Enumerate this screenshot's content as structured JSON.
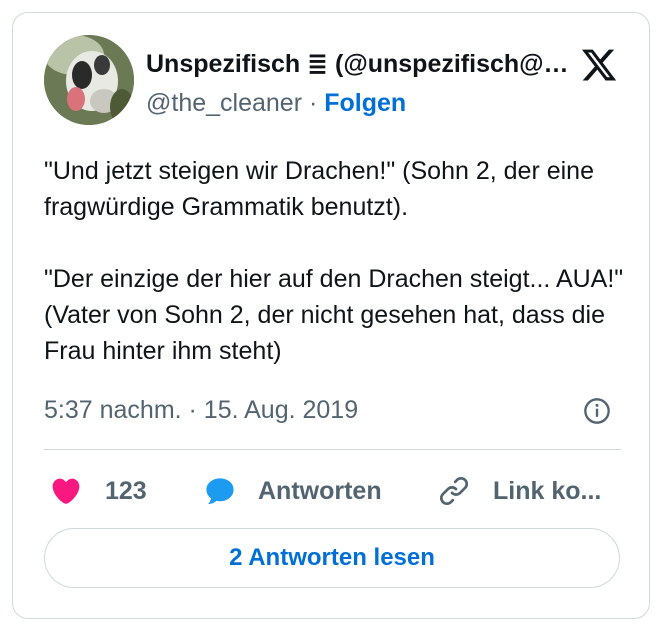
{
  "author": {
    "display_name": "Unspezifisch ≣ (@unspezifisch@mastodon.social)",
    "handle": "@the_cleaner",
    "separator": "·",
    "follow_label": "Folgen"
  },
  "tweet": {
    "text": "\"Und jetzt steigen wir Drachen!\" (Sohn 2, der eine fragwürdige Grammatik benutzt).\n\n\"Der einzige der hier auf den Drachen steigt... AUA!\" (Vater von Sohn 2, der nicht gesehen hat, dass die Frau hinter ihm steht)",
    "timestamp": "5:37 nachm. · 15. Aug. 2019"
  },
  "actions": {
    "like_count": "123",
    "reply_label": "Antworten",
    "copy_link_label": "Link ko..."
  },
  "read_replies_label": "2 Antworten lesen",
  "colors": {
    "accent": "#006fd6",
    "like": "#f91880",
    "reply": "#1d9bf0",
    "muted": "#536471",
    "border": "#cfd9de"
  },
  "icons": [
    "avatar-photo",
    "x-logo-icon",
    "info-icon",
    "heart-icon",
    "speech-bubble-icon",
    "link-icon"
  ]
}
